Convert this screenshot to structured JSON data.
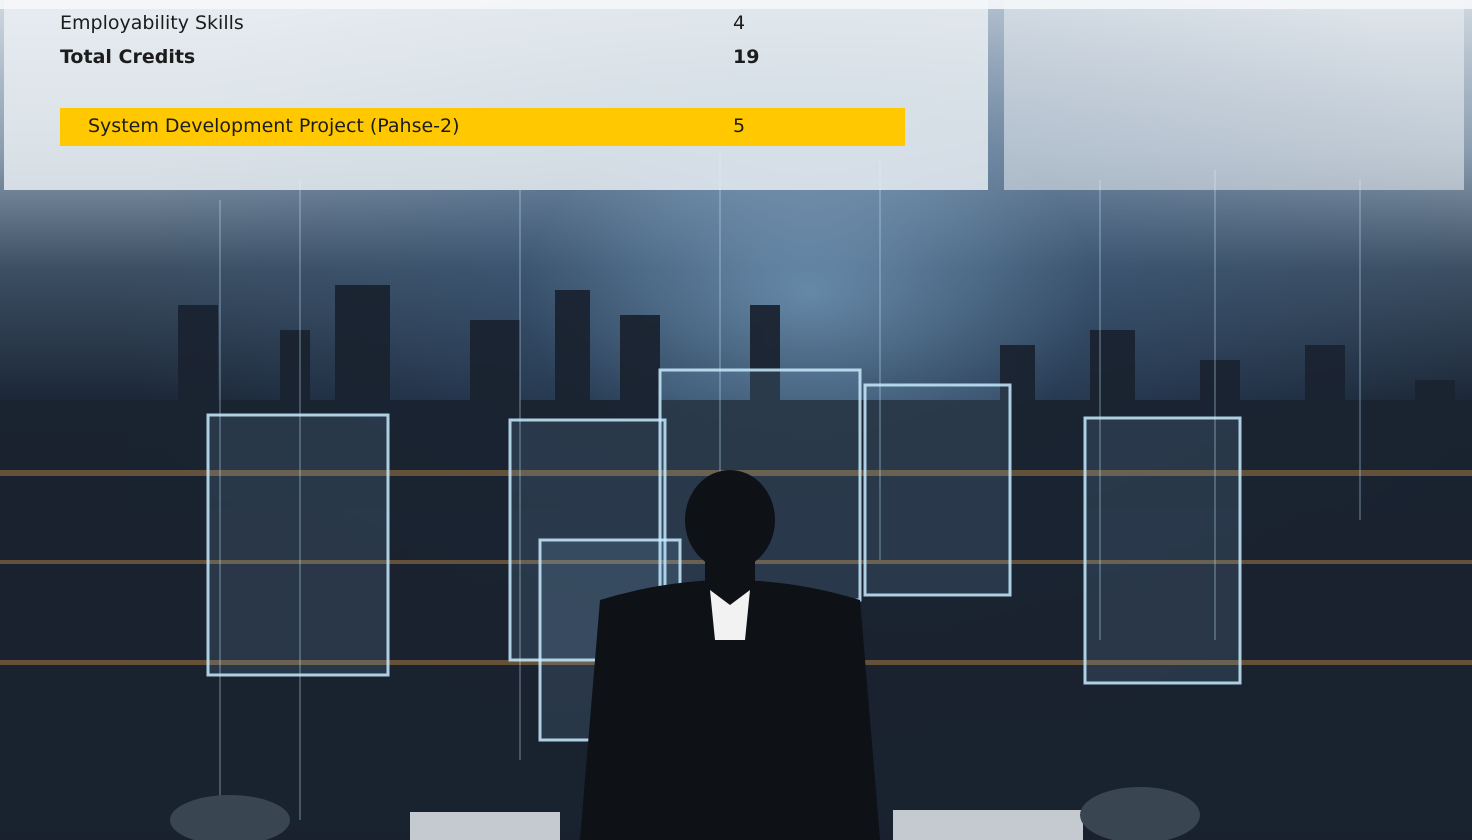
{
  "table": {
    "rows": [
      {
        "name": "Employability Skills",
        "credits": "4"
      },
      {
        "name": "Total Credits",
        "credits": "19"
      }
    ],
    "highlight_row": {
      "name": "System Development Project (Pahse-2)",
      "credits": "5"
    }
  },
  "colors": {
    "highlight": "#ffc800",
    "text": "#1c1c1c"
  }
}
